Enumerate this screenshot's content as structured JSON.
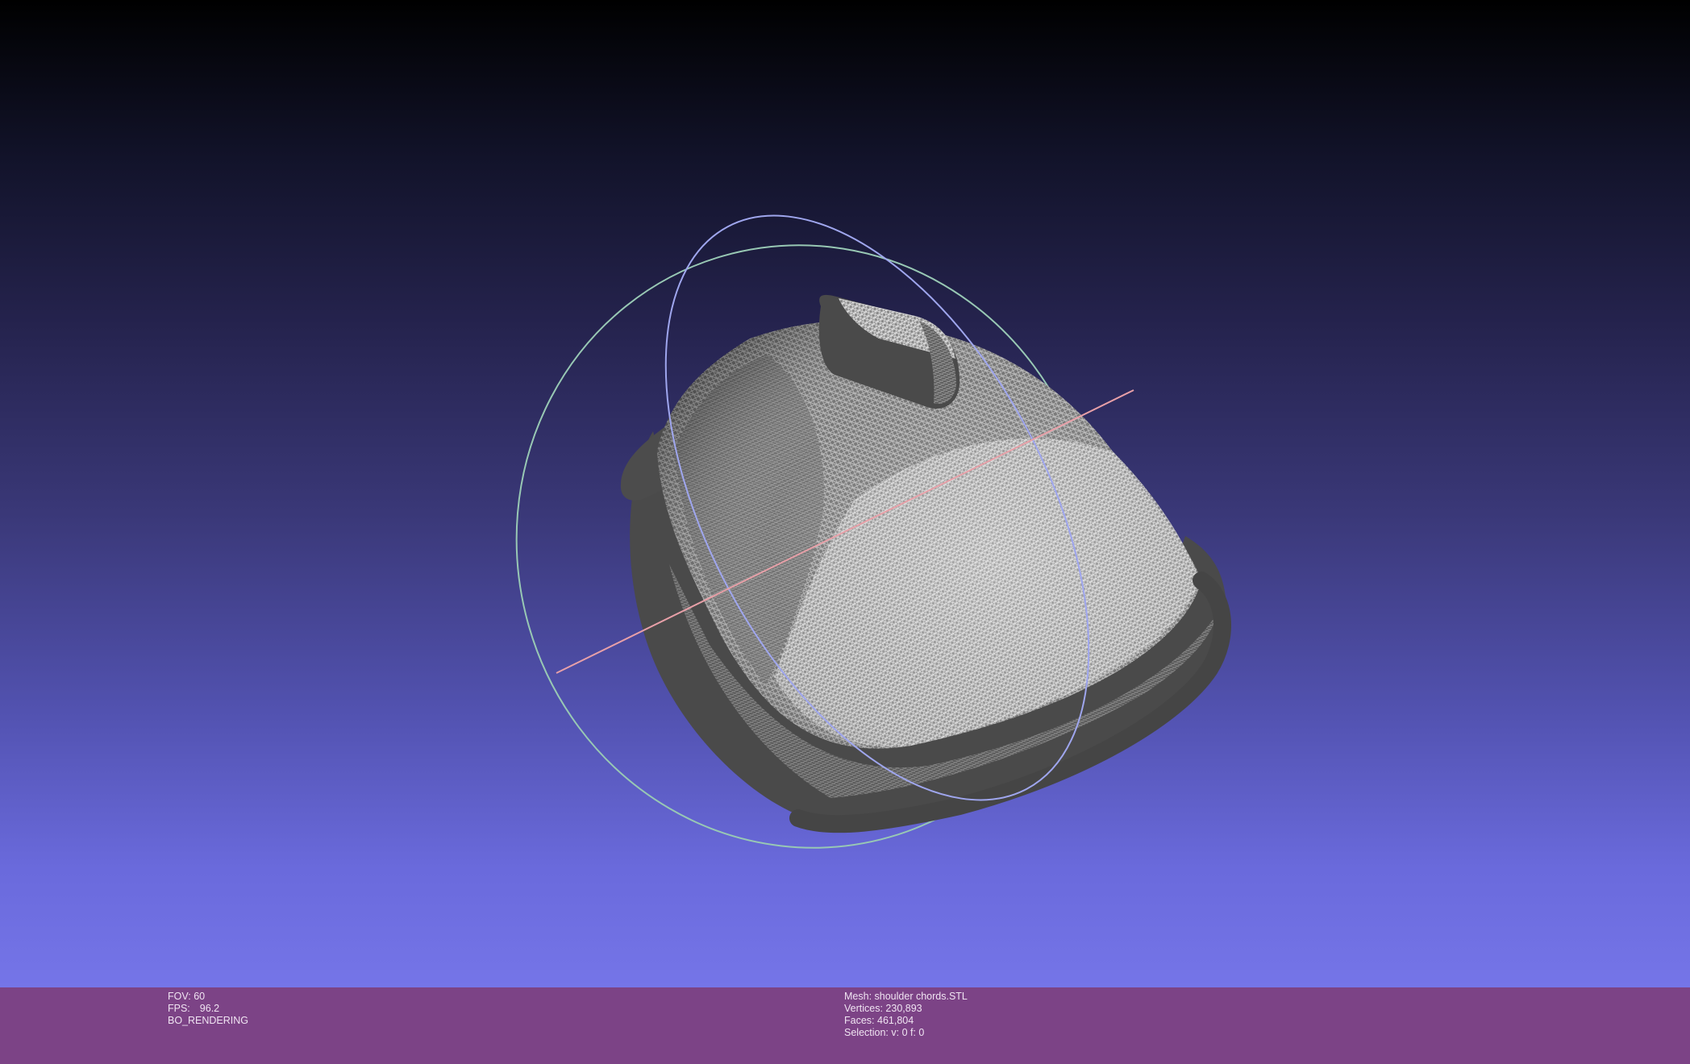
{
  "render_info": {
    "fov_label": "FOV:",
    "fov_value": "60",
    "fps_label": "FPS:",
    "fps_value": "96.2",
    "mode": "BO_RENDERING"
  },
  "mesh_info": {
    "mesh_label": "Mesh:",
    "mesh_name": "shoulder chords.STL",
    "vertices_label": "Vertices:",
    "vertices": "230,893",
    "faces_label": "Faces:",
    "faces": "461,804",
    "selection_label": "Selection:",
    "selection": "v: 0 f: 0"
  },
  "colors": {
    "background_top": "#000000",
    "background_bottom": "#7575e8",
    "status_bar": "#7c4386",
    "mesh": "#4f4f4f",
    "trackball_x": "#e8a0a8",
    "trackball_y": "#9fa6ee",
    "trackball_z": "#98c8b4"
  },
  "icons": [
    "trackball-rings",
    "mesh-wireframe"
  ]
}
